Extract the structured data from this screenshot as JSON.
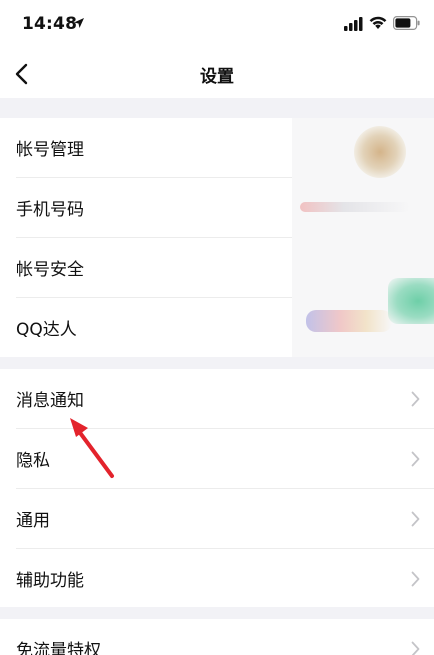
{
  "status_bar": {
    "time": "14:48",
    "icons": [
      "location-arrow-icon",
      "signal-icon",
      "wifi-icon",
      "battery-icon"
    ]
  },
  "nav": {
    "title": "设置",
    "back_icon": "chevron-left-icon"
  },
  "groups": [
    {
      "items": [
        {
          "label": "帐号管理"
        },
        {
          "label": "手机号码"
        },
        {
          "label": "帐号安全"
        },
        {
          "label": "QQ达人"
        }
      ]
    },
    {
      "items": [
        {
          "label": "消息通知"
        },
        {
          "label": "隐私"
        },
        {
          "label": "通用"
        },
        {
          "label": "辅助功能"
        }
      ]
    },
    {
      "items": [
        {
          "label": "免流量特权"
        }
      ]
    }
  ],
  "colors": {
    "background": "#f2f2f6",
    "row_background": "#ffffff",
    "divider": "#ececec",
    "chevron": "#c4c4c8",
    "annotation_arrow": "#e3232c"
  }
}
